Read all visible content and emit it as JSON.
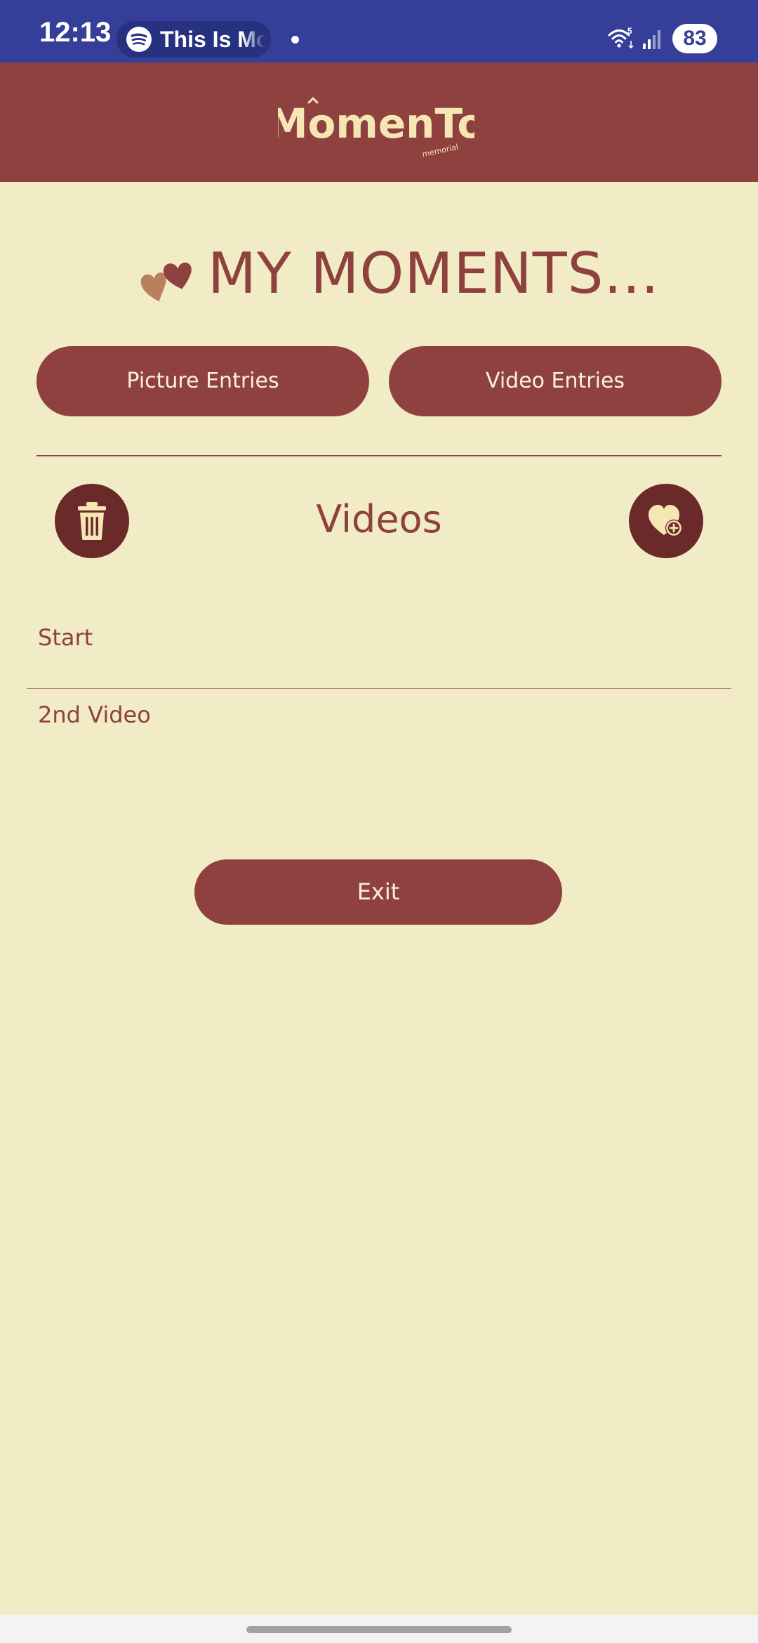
{
  "status_bar": {
    "time": "12:13",
    "media_text": "This Is Mo",
    "battery": "83",
    "wifi_badge": "5"
  },
  "header": {
    "logo_text": "MomenTo",
    "logo_subtext": "memorial"
  },
  "page": {
    "title": "MY MOMENTS..."
  },
  "tabs": [
    {
      "label": "Picture Entries"
    },
    {
      "label": "Video Entries"
    }
  ],
  "section": {
    "title": "Videos"
  },
  "videos": [
    {
      "label": "Start"
    },
    {
      "label": "2nd Video"
    }
  ],
  "exit_label": "Exit",
  "colors": {
    "status_bar": "#353e98",
    "header": "#8e413e",
    "background": "#f2ecc6",
    "button": "#8e413e",
    "button_text": "#fbf1d6",
    "circle_button": "#6a2a2a"
  },
  "icons": {
    "delete": "trash-icon",
    "add": "heart-plus-icon",
    "title_decoration": "hearts-icon"
  }
}
